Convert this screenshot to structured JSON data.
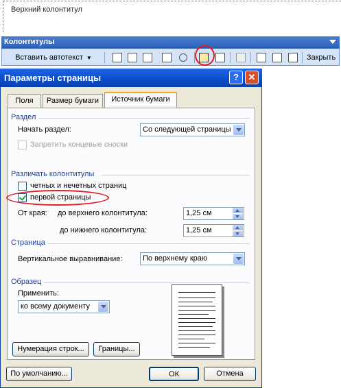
{
  "header_area": {
    "label": "Верхний колонтитул"
  },
  "toolbar": {
    "title": "Колонтитулы",
    "insert_autotext": "Вставить автотекст",
    "close_label": "Закрыть"
  },
  "dialog": {
    "title": "Параметры страницы",
    "tabs": [
      "Поля",
      "Размер бумаги",
      "Источник бумаги"
    ],
    "active_tab": "Источник бумаги",
    "section": {
      "heading": "Раздел",
      "start_label": "Начать раздел:",
      "start_value": "Со следующей страницы",
      "suppress_endnotes": "Запретить концевые сноски"
    },
    "headers_footers": {
      "heading": "Различать колонтитулы",
      "odd_even": "четных и нечетных страниц",
      "first_page": "первой страницы",
      "first_page_checked": true,
      "odd_even_checked": false,
      "from_edge": "От края:",
      "to_header_label": "до верхнего колонтитула:",
      "to_header_value": "1,25 см",
      "to_footer_label": "до нижнего колонтитула:",
      "to_footer_value": "1,25 см"
    },
    "page": {
      "heading": "Страница",
      "valign_label": "Вертикальное выравнивание:",
      "valign_value": "По верхнему краю"
    },
    "preview": {
      "heading": "Образец",
      "apply_label": "Применить:",
      "apply_value": "ко всему документу"
    },
    "buttons": {
      "line_numbers": "Нумерация строк...",
      "borders": "Границы...",
      "default": "По умолчанию...",
      "ok": "ОК",
      "cancel": "Отмена"
    }
  }
}
